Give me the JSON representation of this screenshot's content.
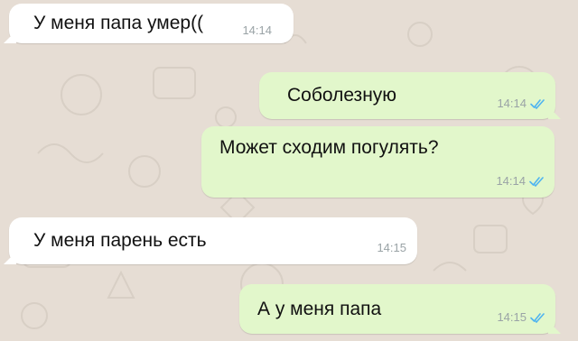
{
  "theme": {
    "background": "#e6ddd4",
    "incoming_bubble": "#ffffff",
    "outgoing_bubble": "#e2f7cb",
    "time_color": "#9aa3a6",
    "read_check_color": "#4fb4f0"
  },
  "messages": [
    {
      "direction": "incoming",
      "text": "У меня папа умер((",
      "time": "14:14"
    },
    {
      "direction": "outgoing",
      "text": "Соболезную",
      "time": "14:14",
      "status_icon": "double-check-icon"
    },
    {
      "direction": "outgoing",
      "text": "Может сходим погулять?",
      "time": "14:14",
      "status_icon": "double-check-icon"
    },
    {
      "direction": "incoming",
      "text": "У меня парень есть",
      "time": "14:15"
    },
    {
      "direction": "outgoing",
      "text": "А у меня папа",
      "time": "14:15",
      "status_icon": "double-check-icon"
    }
  ]
}
